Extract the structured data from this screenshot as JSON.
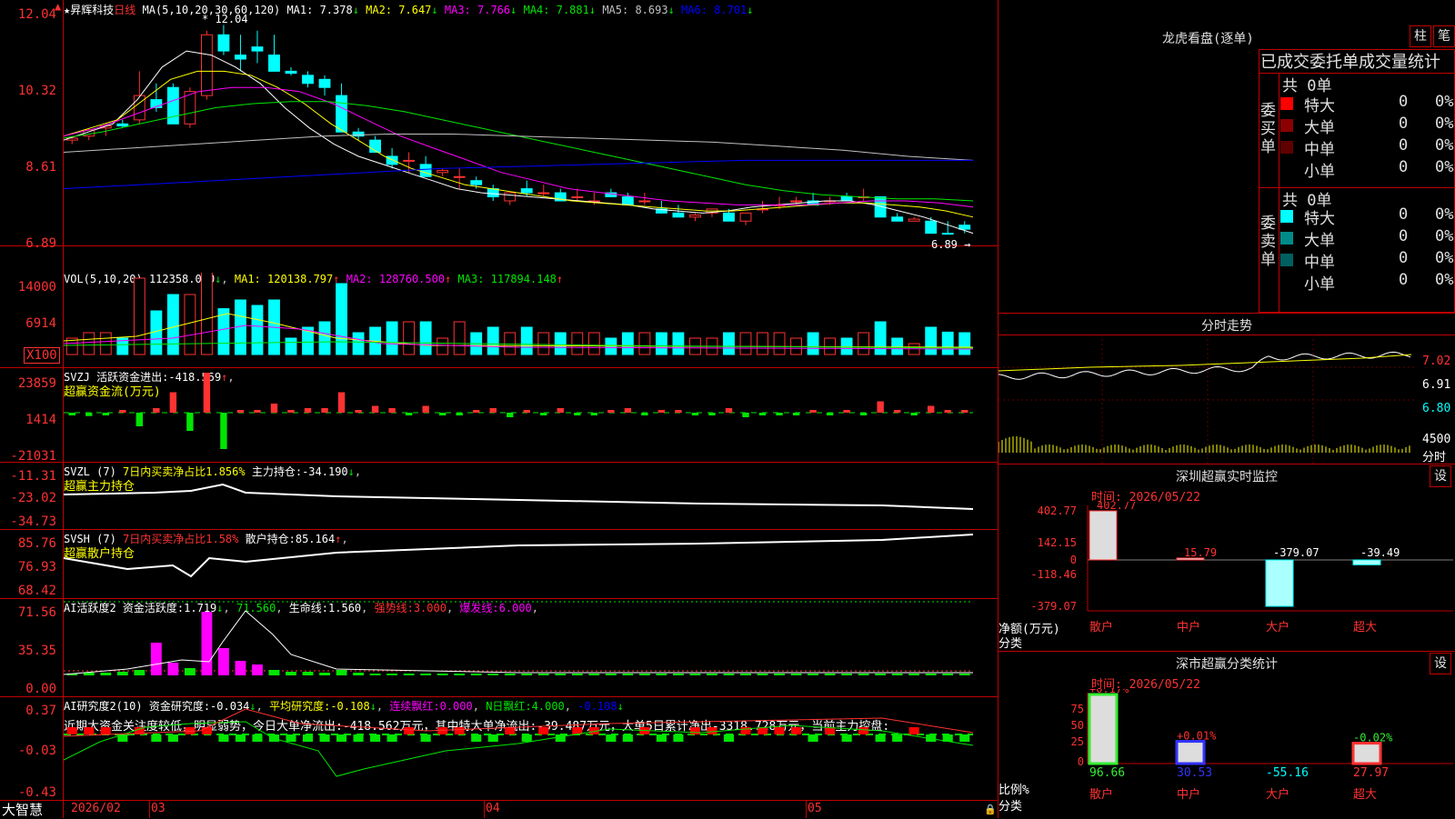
{
  "stock": {
    "name": "昇辉科技",
    "period": "日线",
    "star": "★"
  },
  "ma_line": {
    "label": "MA(5,10,20,30,60,120)",
    "items": [
      {
        "name": "MA1",
        "value": "7.378",
        "arrow": "↓",
        "color": "#ffffff"
      },
      {
        "name": "MA2",
        "value": "7.647",
        "arrow": "↓",
        "color": "#ffff00"
      },
      {
        "name": "MA3",
        "value": "7.766",
        "arrow": "↓",
        "color": "#ff00ff"
      },
      {
        "name": "MA4",
        "value": "7.881",
        "arrow": "↓",
        "color": "#00e600"
      },
      {
        "name": "MA5",
        "value": "8.693",
        "arrow": "↓",
        "color": "#c0c0c0"
      },
      {
        "name": "MA6",
        "value": "8.701",
        "arrow": "↓",
        "color": "#0000ff"
      }
    ]
  },
  "price_axis": [
    "12.04",
    "10.32",
    "8.61",
    "6.89"
  ],
  "price_marks": {
    "high": "12.04",
    "low": "6.89"
  },
  "vol_line": {
    "label": "VOL(5,10,20)",
    "value": "112358.000",
    "arrow": "↓",
    "items": [
      {
        "name": "MA1",
        "value": "120138.797",
        "arrow": "↑",
        "color": "#ffff00"
      },
      {
        "name": "MA2",
        "value": "128760.500",
        "arrow": "↑",
        "color": "#ff00ff"
      },
      {
        "name": "MA3",
        "value": "117894.148",
        "arrow": "↑",
        "color": "#00e600"
      }
    ]
  },
  "vol_axis": [
    "14000",
    "6914"
  ],
  "vol_unit": "X100",
  "svzj": {
    "label": "SVZJ",
    "desc": "活跃资金进出:",
    "value": "-418.559",
    "arrow": "↑",
    "sub": "超赢资金流(万元)",
    "axis": [
      "23859",
      "1414",
      "-21031"
    ]
  },
  "svzl": {
    "label": "SVZL (7)",
    "desc": "7日内买卖净占比1.856%",
    "desc2": "主力持仓:",
    "value": "-34.190",
    "arrow": "↓",
    "sub": "超赢主力持仓",
    "axis": [
      "-11.31",
      "-23.02",
      "-34.73"
    ]
  },
  "svsh": {
    "label": "SVSH (7)",
    "desc": "7日内买卖净占比1.58%",
    "desc2": "散户持仓:",
    "value": "85.164",
    "arrow": "↑",
    "sub": "超赢散户持仓",
    "axis": [
      "85.76",
      "76.93",
      "68.42"
    ]
  },
  "ai_active": {
    "label": "AI活跃度2",
    "desc": "资金活跃度:",
    "value": "1.719",
    "arrow": "↓",
    "v2": "71.560",
    "life": "生命线:",
    "life_value": "1.560",
    "strong": "强势线:",
    "strong_value": "3.000",
    "burst": "爆发线:",
    "burst_value": "6.000",
    "axis": [
      "71.56",
      "35.35",
      "0.00"
    ]
  },
  "ai_research": {
    "label": "AI研究度2(10)",
    "desc": "资金研究度:",
    "value": "-0.034",
    "arrow": "↓",
    "avg": "平均研究度:",
    "avg_value": "-0.108",
    "lianxu": "连续飘红:",
    "lianxu_value": "0.000",
    "nday": "N日飘红:",
    "nday_value": "4.000",
    "last": "-0.108",
    "text": "近期大资金关注度较低，明显弱势，今日大单净流出:-418.562万元，其中特大单净流出:-39.487万元，大单5日累计净出-3318.728万元，当前主力控盘:",
    "axis": [
      "0.37",
      "-0.03",
      "-0.43"
    ]
  },
  "dates": {
    "brand": "大智慧",
    "d1": "2026/02",
    "d2": "03",
    "d3": "04",
    "d4": "05"
  },
  "right": {
    "lhb_title": "龙虎看盘(逐单)",
    "btn_zhu": "柱",
    "btn_bi": "笔",
    "deal_header": "已成交委托单成交量统计",
    "buy_group": {
      "label": "委\n买\n单",
      "total": "共 0单",
      "rows": [
        {
          "label": "特大",
          "count": "0",
          "pct": "0%",
          "color": "#ff0000"
        },
        {
          "label": "大单",
          "count": "0",
          "pct": "0%",
          "color": "#8b0000"
        },
        {
          "label": "中单",
          "count": "0",
          "pct": "0%",
          "color": "#600000"
        },
        {
          "label": "小单",
          "count": "0",
          "pct": "0%",
          "color": "#000000"
        }
      ]
    },
    "sell_group": {
      "label": "委\n卖\n单",
      "total": "共 0单",
      "rows": [
        {
          "label": "特大",
          "count": "0",
          "pct": "0%",
          "color": "#00ffff"
        },
        {
          "label": "大单",
          "count": "0",
          "pct": "0%",
          "color": "#008b8b"
        },
        {
          "label": "中单",
          "count": "0",
          "pct": "0%",
          "color": "#006060"
        },
        {
          "label": "小单",
          "count": "0",
          "pct": "0%",
          "color": "#000000"
        }
      ]
    },
    "fs_title": "分时走势",
    "fs_axis": [
      "7.02",
      "6.91",
      "6.80"
    ],
    "fs_vol": "4500",
    "fs_vol_label": "分时",
    "monitor_title": "深圳超赢实时监控",
    "monitor_btn": "设",
    "monitor_time": "时间: 2026/05/22",
    "monitor_axis": [
      "402.77",
      "142.15",
      "0",
      "-118.46",
      "-379.07"
    ],
    "monitor_unit": "净额(万元)",
    "monitor_cat": "分类",
    "monitor_bars": [
      {
        "label": "散户",
        "value": 402.77,
        "text": "402.77"
      },
      {
        "label": "中户",
        "value": 15.79,
        "text": "15.79"
      },
      {
        "label": "大户",
        "value": -379.07,
        "text": "-379.07"
      },
      {
        "label": "超大",
        "value": -39.49,
        "text": "-39.49"
      }
    ],
    "cls_title": "深市超赢分类统计",
    "cls_btn": "设",
    "cls_time": "时间: 2026/05/22",
    "cls_axis": [
      "75",
      "50",
      "25",
      "0"
    ],
    "cls_unit": "比例%",
    "cls_cat": "分类",
    "cls_bars": [
      {
        "label": "散户",
        "value": 96.66,
        "pct": "+0.17%",
        "text": "96.66"
      },
      {
        "label": "中户",
        "value": 30.53,
        "pct": "+0.01%",
        "text": "30.53"
      },
      {
        "label": "大户",
        "value": -55.16,
        "pct": "",
        "text": "-55.16"
      },
      {
        "label": "超大",
        "value": 27.97,
        "pct": "-0.02%",
        "text": "27.97"
      }
    ]
  },
  "chart_data": {
    "type": "candlestick",
    "candles": [
      [
        9.2,
        9.3,
        9.1,
        9.25
      ],
      [
        9.3,
        9.5,
        9.2,
        9.45
      ],
      [
        9.5,
        9.6,
        9.3,
        9.55
      ],
      [
        9.6,
        9.7,
        9.5,
        9.55
      ],
      [
        9.7,
        10.9,
        9.6,
        10.3
      ],
      [
        10.2,
        10.6,
        9.9,
        10.0
      ],
      [
        10.5,
        10.6,
        9.6,
        9.6
      ],
      [
        9.6,
        10.5,
        9.5,
        10.4
      ],
      [
        10.3,
        11.9,
        10.2,
        11.8
      ],
      [
        11.8,
        12.04,
        11.3,
        11.4
      ],
      [
        11.3,
        11.8,
        10.9,
        11.2
      ],
      [
        11.5,
        11.9,
        11.1,
        11.4
      ],
      [
        11.3,
        11.8,
        10.9,
        10.9
      ],
      [
        10.9,
        11.0,
        10.8,
        10.85
      ],
      [
        10.8,
        10.9,
        10.5,
        10.6
      ],
      [
        10.7,
        10.8,
        10.3,
        10.5
      ],
      [
        10.3,
        10.6,
        9.4,
        9.4
      ],
      [
        9.4,
        9.5,
        9.2,
        9.3
      ],
      [
        9.2,
        9.3,
        8.9,
        8.9
      ],
      [
        8.8,
        9.0,
        8.5,
        8.6
      ],
      [
        8.7,
        8.9,
        8.4,
        8.7
      ],
      [
        8.6,
        8.8,
        8.3,
        8.3
      ],
      [
        8.4,
        8.5,
        8.3,
        8.45
      ],
      [
        8.3,
        8.5,
        8.0,
        8.3
      ],
      [
        8.2,
        8.3,
        8.0,
        8.1
      ],
      [
        8.0,
        8.1,
        7.7,
        7.8
      ],
      [
        7.7,
        7.9,
        7.6,
        7.9
      ],
      [
        8.0,
        8.2,
        7.8,
        7.9
      ],
      [
        7.9,
        8.1,
        7.8,
        7.9
      ],
      [
        7.9,
        8.0,
        7.7,
        7.7
      ],
      [
        7.8,
        8.0,
        7.7,
        7.8
      ],
      [
        7.7,
        7.9,
        7.6,
        7.7
      ],
      [
        7.9,
        8.0,
        7.8,
        7.8
      ],
      [
        7.8,
        7.9,
        7.6,
        7.6
      ],
      [
        7.7,
        7.9,
        7.6,
        7.7
      ],
      [
        7.5,
        7.7,
        7.4,
        7.4
      ],
      [
        7.4,
        7.6,
        7.3,
        7.3
      ],
      [
        7.3,
        7.4,
        7.2,
        7.35
      ],
      [
        7.4,
        7.5,
        7.3,
        7.5
      ],
      [
        7.4,
        7.5,
        7.2,
        7.2
      ],
      [
        7.2,
        7.4,
        7.1,
        7.4
      ],
      [
        7.5,
        7.7,
        7.4,
        7.5
      ],
      [
        7.6,
        7.8,
        7.5,
        7.6
      ],
      [
        7.7,
        7.8,
        7.6,
        7.7
      ],
      [
        7.7,
        7.9,
        7.6,
        7.6
      ],
      [
        7.7,
        7.8,
        7.6,
        7.7
      ],
      [
        7.8,
        7.9,
        7.7,
        7.7
      ],
      [
        7.8,
        8.0,
        7.7,
        7.8
      ],
      [
        7.8,
        7.8,
        7.3,
        7.3
      ],
      [
        7.3,
        7.4,
        7.2,
        7.2
      ],
      [
        7.2,
        7.3,
        7.2,
        7.25
      ],
      [
        7.2,
        7.3,
        6.9,
        6.9
      ],
      [
        6.9,
        7.2,
        6.89,
        6.89
      ],
      [
        7.1,
        7.2,
        6.9,
        7.0
      ]
    ],
    "ma": {
      "MA1": [
        9.2,
        9.4,
        9.6,
        10.2,
        11.0,
        11.4,
        11.3,
        11.0,
        10.6,
        10.0,
        9.5,
        9.1,
        8.8,
        8.6,
        8.4,
        8.2,
        8.0,
        7.9,
        7.85,
        7.8,
        7.75,
        7.7,
        7.65,
        7.6,
        7.5,
        7.45,
        7.4,
        7.45,
        7.55,
        7.6,
        7.65,
        7.7,
        7.7,
        7.6,
        7.45,
        7.3,
        7.1,
        6.9
      ],
      "MA2": [
        9.3,
        9.5,
        9.7,
        10.2,
        10.7,
        10.9,
        10.9,
        10.8,
        10.5,
        10.1,
        9.6,
        9.2,
        8.8,
        8.5,
        8.3,
        8.1,
        8.0,
        7.9,
        7.8,
        7.7,
        7.65,
        7.6,
        7.55,
        7.5,
        7.45,
        7.45,
        7.5,
        7.55,
        7.6,
        7.65,
        7.65,
        7.6,
        7.55,
        7.45,
        7.3
      ],
      "MA3": [
        9.3,
        9.5,
        9.8,
        10.1,
        10.4,
        10.5,
        10.5,
        10.4,
        10.1,
        9.7,
        9.3,
        9.0,
        8.7,
        8.4,
        8.2,
        8.0,
        7.9,
        7.8,
        7.7,
        7.65,
        7.6,
        7.6,
        7.6,
        7.65,
        7.7,
        7.7,
        7.65,
        7.55
      ],
      "MA4": [
        9.25,
        9.4,
        9.6,
        9.8,
        10.0,
        10.1,
        10.15,
        10.15,
        10.05,
        9.9,
        9.7,
        9.5,
        9.3,
        9.1,
        8.9,
        8.7,
        8.5,
        8.3,
        8.1,
        7.95,
        7.85,
        7.8,
        7.75,
        7.75,
        7.7
      ],
      "MA5": [
        8.9,
        9.0,
        9.1,
        9.2,
        9.3,
        9.35,
        9.35,
        9.3,
        9.25,
        9.2,
        9.15,
        9.05,
        8.95,
        8.8,
        8.7
      ],
      "MA6": [
        8.0,
        8.1,
        8.2,
        8.3,
        8.4,
        8.5,
        8.55,
        8.6,
        8.65,
        8.7,
        8.7,
        8.7,
        8.7
      ]
    }
  }
}
